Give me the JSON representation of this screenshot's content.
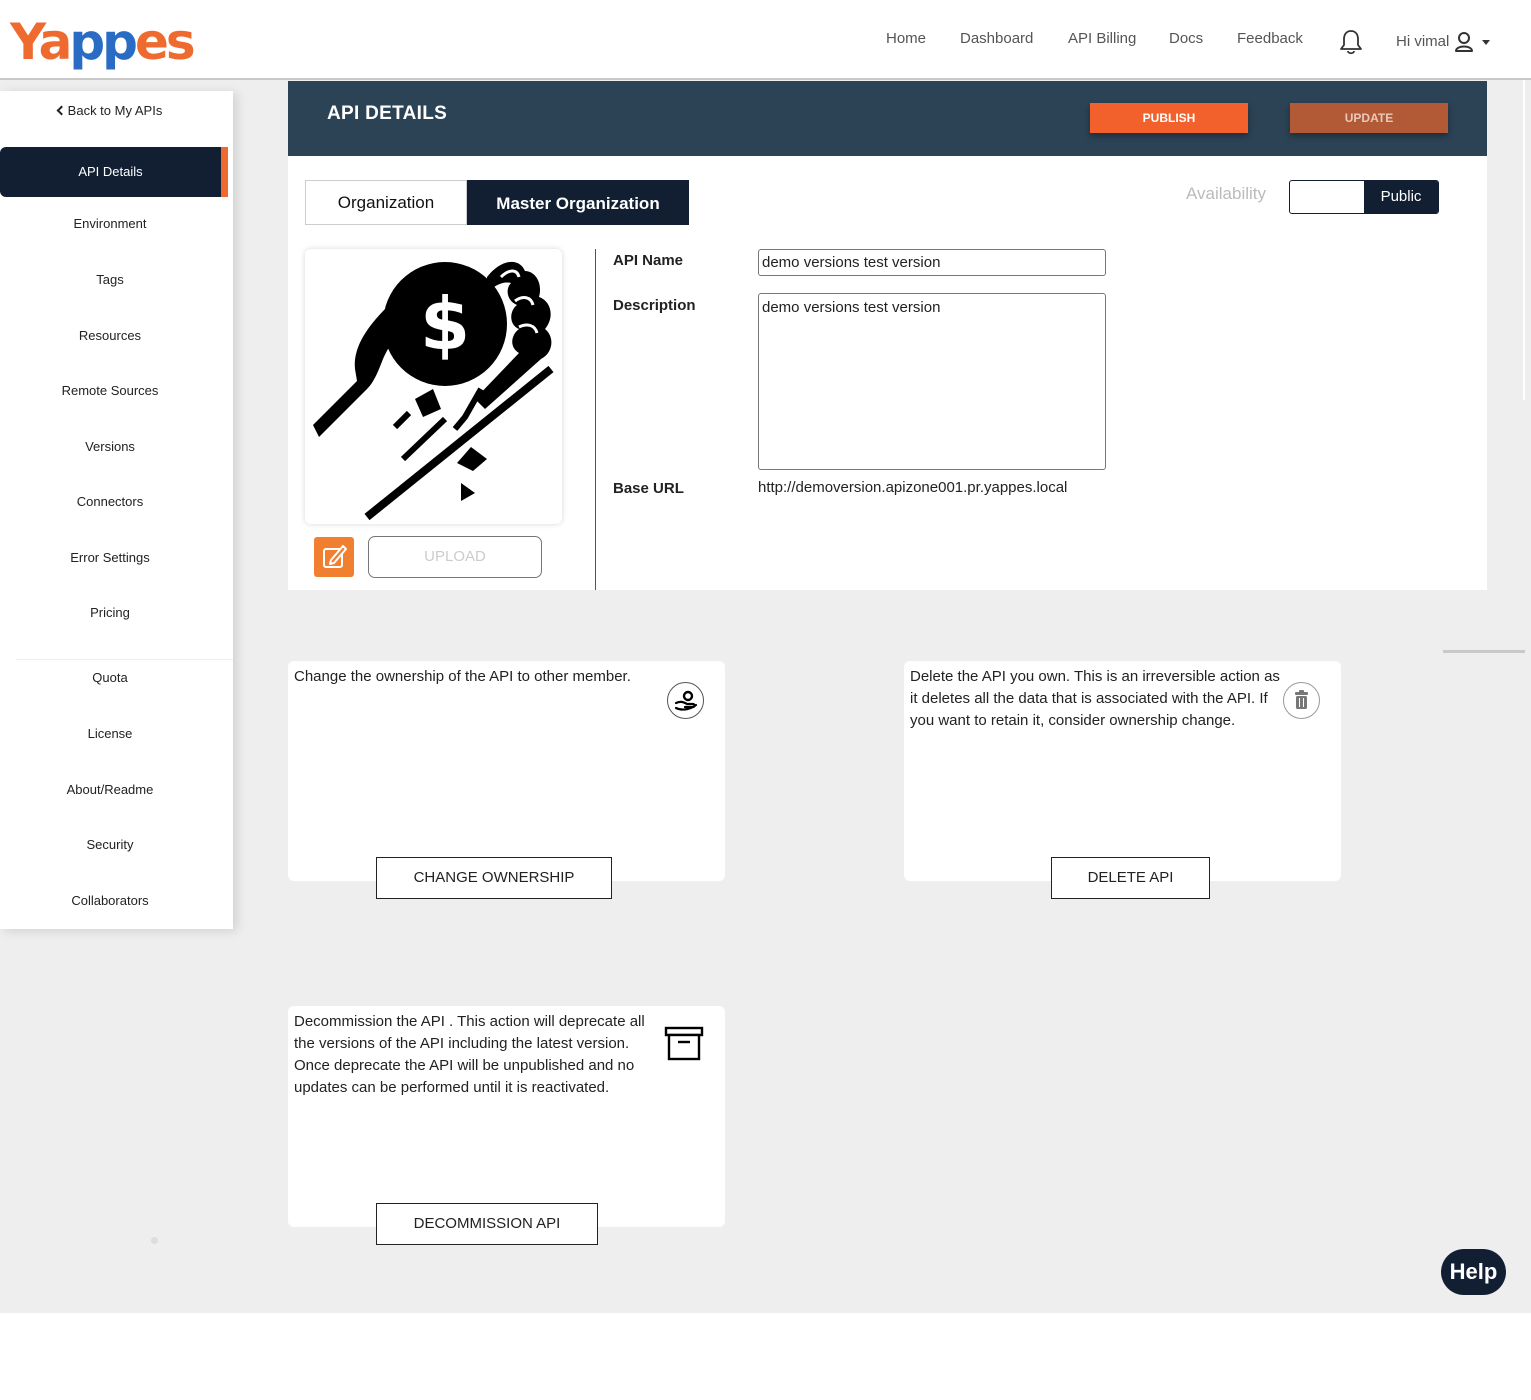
{
  "header": {
    "logo_text": "Yappes",
    "nav": [
      {
        "label": "Home"
      },
      {
        "label": "Dashboard"
      },
      {
        "label": "API Billing"
      },
      {
        "label": "Docs"
      },
      {
        "label": "Feedback"
      }
    ],
    "user_greeting": "Hi vimal"
  },
  "sidebar": {
    "back_label": "Back to My APIs",
    "active_item": "API Details",
    "items": [
      {
        "label": "API Details"
      },
      {
        "label": "Environment"
      },
      {
        "label": "Tags"
      },
      {
        "label": "Resources"
      },
      {
        "label": "Remote Sources"
      },
      {
        "label": "Versions"
      },
      {
        "label": "Connectors"
      },
      {
        "label": "Error Settings"
      },
      {
        "label": "Pricing"
      },
      {
        "label": "Quota"
      },
      {
        "label": "License"
      },
      {
        "label": "About/Readme"
      },
      {
        "label": "Security"
      },
      {
        "label": "Collaborators"
      }
    ]
  },
  "panel": {
    "title": "API DETAILS",
    "publish_label": "PUBLISH",
    "update_label": "UPDATE",
    "tabs": [
      {
        "label": "Organization",
        "active": false
      },
      {
        "label": "Master Organization",
        "active": true
      }
    ],
    "availability_label": "Availability",
    "availability_value": "Public",
    "upload_label": "UPLOAD",
    "fields": {
      "api_name_label": "API Name",
      "api_name_value": "demo versions test version",
      "description_label": "Description",
      "description_value": "demo versions test version",
      "base_url_label": "Base URL",
      "base_url_value": "http://demoversion.apizone001.pr.yappes.local"
    }
  },
  "cards": {
    "ownership": {
      "text": "Change the ownership of the API to other member.",
      "button": "CHANGE OWNERSHIP"
    },
    "delete": {
      "text": "Delete the API you own. This is an irreversible action as it deletes all the data that is associated with the API. If you want to retain it, consider ownership change.",
      "button": "DELETE API"
    },
    "decommission": {
      "text": "Decommission the API . This action will deprecate all the versions of the API including the latest version. Once deprecate the API will be unpublished and no updates can be performed until it is reactivated.",
      "button": "DECOMMISSION API"
    }
  },
  "help_label": "Help",
  "colors": {
    "brand_orange": "#f2612c",
    "navy": "#121f33",
    "panel_header": "#2c4356"
  }
}
